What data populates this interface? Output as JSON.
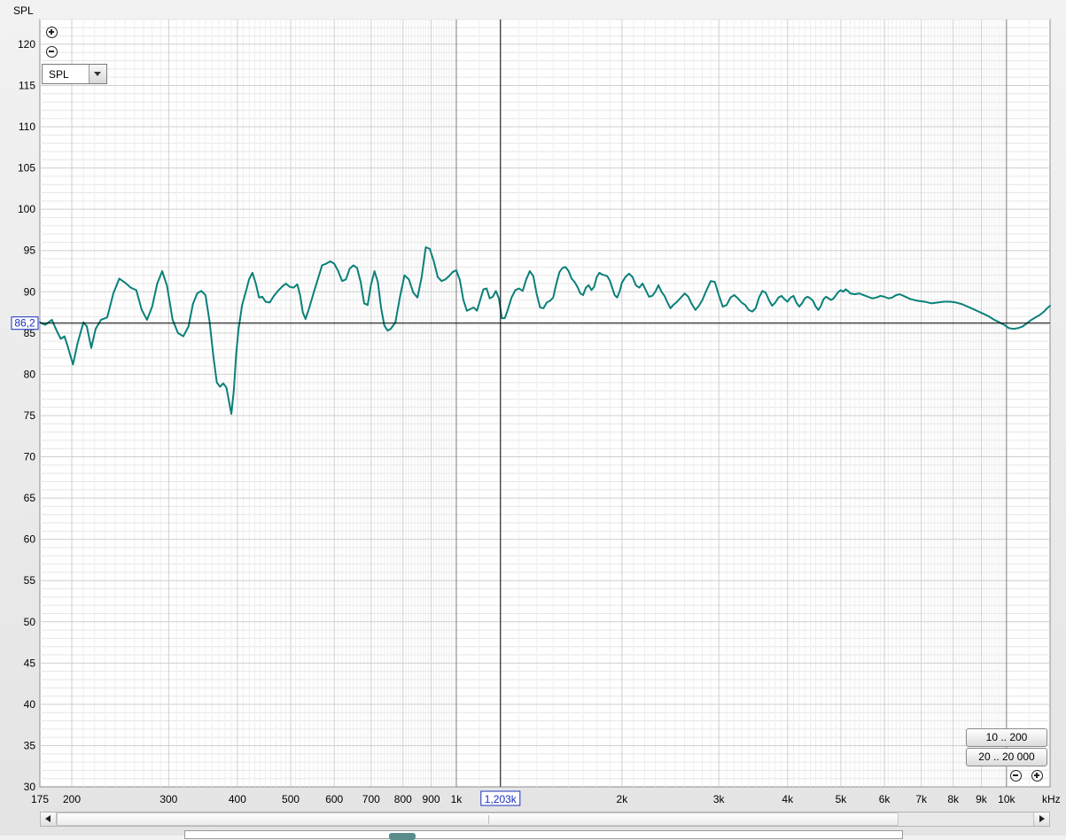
{
  "chart_data": {
    "type": "line",
    "ylabel": "SPL",
    "x_unit": "kHz",
    "x_scale": "log",
    "xlim": [
      175,
      12000
    ],
    "ylim": [
      30,
      123
    ],
    "y_ticks": [
      30,
      35,
      40,
      45,
      50,
      55,
      60,
      65,
      70,
      75,
      80,
      85,
      90,
      95,
      100,
      105,
      110,
      115,
      120
    ],
    "x_ticks": [
      {
        "value": 175,
        "label": "175"
      },
      {
        "value": 200,
        "label": "200"
      },
      {
        "value": 300,
        "label": "300"
      },
      {
        "value": 400,
        "label": "400"
      },
      {
        "value": 500,
        "label": "500"
      },
      {
        "value": 600,
        "label": "600"
      },
      {
        "value": 700,
        "label": "700"
      },
      {
        "value": 800,
        "label": "800"
      },
      {
        "value": 900,
        "label": "900"
      },
      {
        "value": 1000,
        "label": "1k"
      },
      {
        "value": 2000,
        "label": "2k"
      },
      {
        "value": 3000,
        "label": "3k"
      },
      {
        "value": 4000,
        "label": "4k"
      },
      {
        "value": 5000,
        "label": "5k"
      },
      {
        "value": 6000,
        "label": "6k"
      },
      {
        "value": 7000,
        "label": "7k"
      },
      {
        "value": 8000,
        "label": "8k"
      },
      {
        "value": 9000,
        "label": "9k"
      },
      {
        "value": 10000,
        "label": "10k"
      }
    ],
    "grid": true,
    "cursor": {
      "x": 1203,
      "y": 86.2,
      "x_label": "1,203k",
      "y_label": "86,2"
    },
    "series": [
      {
        "color": "#0a8079",
        "points": [
          [
            175,
            86.3
          ],
          [
            179,
            86.0
          ],
          [
            184,
            86.6
          ],
          [
            188,
            85.2
          ],
          [
            191,
            84.3
          ],
          [
            194,
            84.6
          ],
          [
            197,
            83.2
          ],
          [
            201,
            81.2
          ],
          [
            205,
            83.8
          ],
          [
            210,
            86.3
          ],
          [
            213,
            85.8
          ],
          [
            217,
            83.2
          ],
          [
            221,
            85.5
          ],
          [
            226,
            86.6
          ],
          [
            232,
            86.9
          ],
          [
            238,
            89.8
          ],
          [
            244,
            91.6
          ],
          [
            250,
            91.1
          ],
          [
            256,
            90.5
          ],
          [
            262,
            90.2
          ],
          [
            268,
            87.8
          ],
          [
            274,
            86.6
          ],
          [
            280,
            88.2
          ],
          [
            286,
            91.0
          ],
          [
            292,
            92.5
          ],
          [
            298,
            90.7
          ],
          [
            305,
            86.6
          ],
          [
            312,
            85.0
          ],
          [
            319,
            84.6
          ],
          [
            326,
            85.8
          ],
          [
            332,
            88.5
          ],
          [
            338,
            89.8
          ],
          [
            344,
            90.1
          ],
          [
            350,
            89.6
          ],
          [
            356,
            86.4
          ],
          [
            362,
            82.0
          ],
          [
            367,
            79.0
          ],
          [
            372,
            78.5
          ],
          [
            377,
            78.9
          ],
          [
            382,
            78.4
          ],
          [
            386,
            76.8
          ],
          [
            390,
            75.2
          ],
          [
            394,
            78.0
          ],
          [
            398,
            82.5
          ],
          [
            402,
            85.5
          ],
          [
            408,
            88.4
          ],
          [
            414,
            89.9
          ],
          [
            420,
            91.5
          ],
          [
            426,
            92.3
          ],
          [
            432,
            91.0
          ],
          [
            438,
            89.3
          ],
          [
            444,
            89.4
          ],
          [
            450,
            88.8
          ],
          [
            458,
            88.7
          ],
          [
            466,
            89.5
          ],
          [
            474,
            90.1
          ],
          [
            482,
            90.6
          ],
          [
            490,
            91.0
          ],
          [
            498,
            90.6
          ],
          [
            506,
            90.5
          ],
          [
            514,
            90.9
          ],
          [
            520,
            89.6
          ],
          [
            526,
            87.5
          ],
          [
            532,
            86.7
          ],
          [
            540,
            88.0
          ],
          [
            550,
            89.8
          ],
          [
            560,
            91.5
          ],
          [
            570,
            93.2
          ],
          [
            580,
            93.4
          ],
          [
            590,
            93.7
          ],
          [
            600,
            93.4
          ],
          [
            610,
            92.5
          ],
          [
            620,
            91.3
          ],
          [
            630,
            91.5
          ],
          [
            640,
            92.8
          ],
          [
            650,
            93.2
          ],
          [
            660,
            92.9
          ],
          [
            670,
            91.2
          ],
          [
            680,
            88.6
          ],
          [
            690,
            88.4
          ],
          [
            700,
            90.9
          ],
          [
            710,
            92.5
          ],
          [
            720,
            91.2
          ],
          [
            730,
            88.0
          ],
          [
            740,
            85.9
          ],
          [
            750,
            85.3
          ],
          [
            760,
            85.5
          ],
          [
            775,
            86.3
          ],
          [
            790,
            89.4
          ],
          [
            805,
            92.0
          ],
          [
            820,
            91.5
          ],
          [
            835,
            89.9
          ],
          [
            850,
            89.3
          ],
          [
            865,
            91.8
          ],
          [
            880,
            95.4
          ],
          [
            895,
            95.2
          ],
          [
            910,
            93.7
          ],
          [
            925,
            91.8
          ],
          [
            940,
            91.3
          ],
          [
            955,
            91.5
          ],
          [
            970,
            91.9
          ],
          [
            985,
            92.4
          ],
          [
            1000,
            92.6
          ],
          [
            1015,
            91.4
          ],
          [
            1030,
            89.0
          ],
          [
            1045,
            87.7
          ],
          [
            1060,
            87.9
          ],
          [
            1075,
            88.1
          ],
          [
            1090,
            87.7
          ],
          [
            1105,
            89.0
          ],
          [
            1120,
            90.3
          ],
          [
            1135,
            90.4
          ],
          [
            1150,
            89.2
          ],
          [
            1165,
            89.4
          ],
          [
            1180,
            90.1
          ],
          [
            1195,
            89.2
          ],
          [
            1210,
            86.8
          ],
          [
            1225,
            86.8
          ],
          [
            1240,
            87.8
          ],
          [
            1260,
            89.3
          ],
          [
            1280,
            90.2
          ],
          [
            1300,
            90.4
          ],
          [
            1320,
            90.1
          ],
          [
            1340,
            91.5
          ],
          [
            1360,
            92.5
          ],
          [
            1380,
            91.9
          ],
          [
            1400,
            89.7
          ],
          [
            1420,
            88.1
          ],
          [
            1440,
            88.0
          ],
          [
            1460,
            88.7
          ],
          [
            1480,
            88.9
          ],
          [
            1500,
            89.3
          ],
          [
            1520,
            91.0
          ],
          [
            1540,
            92.4
          ],
          [
            1560,
            92.9
          ],
          [
            1580,
            93.0
          ],
          [
            1600,
            92.5
          ],
          [
            1620,
            91.6
          ],
          [
            1640,
            91.2
          ],
          [
            1660,
            90.6
          ],
          [
            1680,
            89.8
          ],
          [
            1700,
            89.6
          ],
          [
            1720,
            90.5
          ],
          [
            1740,
            90.8
          ],
          [
            1760,
            90.2
          ],
          [
            1780,
            90.6
          ],
          [
            1800,
            91.8
          ],
          [
            1820,
            92.3
          ],
          [
            1840,
            92.1
          ],
          [
            1860,
            92.0
          ],
          [
            1880,
            91.9
          ],
          [
            1900,
            91.4
          ],
          [
            1920,
            90.5
          ],
          [
            1940,
            89.6
          ],
          [
            1960,
            89.3
          ],
          [
            1980,
            90.0
          ],
          [
            2000,
            91.1
          ],
          [
            2030,
            91.8
          ],
          [
            2060,
            92.2
          ],
          [
            2090,
            91.8
          ],
          [
            2120,
            90.8
          ],
          [
            2150,
            90.5
          ],
          [
            2180,
            91.0
          ],
          [
            2210,
            90.2
          ],
          [
            2240,
            89.4
          ],
          [
            2270,
            89.5
          ],
          [
            2300,
            90.0
          ],
          [
            2330,
            90.8
          ],
          [
            2360,
            90.0
          ],
          [
            2390,
            89.5
          ],
          [
            2420,
            88.7
          ],
          [
            2450,
            88.0
          ],
          [
            2480,
            88.4
          ],
          [
            2520,
            88.8
          ],
          [
            2560,
            89.3
          ],
          [
            2600,
            89.8
          ],
          [
            2640,
            89.4
          ],
          [
            2680,
            88.5
          ],
          [
            2720,
            87.8
          ],
          [
            2760,
            88.3
          ],
          [
            2800,
            89.0
          ],
          [
            2850,
            90.2
          ],
          [
            2900,
            91.3
          ],
          [
            2950,
            91.2
          ],
          [
            3000,
            89.6
          ],
          [
            3050,
            88.2
          ],
          [
            3100,
            88.4
          ],
          [
            3150,
            89.3
          ],
          [
            3200,
            89.6
          ],
          [
            3250,
            89.2
          ],
          [
            3300,
            88.7
          ],
          [
            3350,
            88.4
          ],
          [
            3400,
            87.8
          ],
          [
            3450,
            87.6
          ],
          [
            3500,
            88.0
          ],
          [
            3550,
            89.3
          ],
          [
            3600,
            90.1
          ],
          [
            3650,
            89.9
          ],
          [
            3700,
            89.0
          ],
          [
            3750,
            88.3
          ],
          [
            3800,
            88.7
          ],
          [
            3850,
            89.3
          ],
          [
            3900,
            89.5
          ],
          [
            3950,
            89.1
          ],
          [
            4000,
            88.8
          ],
          [
            4050,
            89.3
          ],
          [
            4100,
            89.5
          ],
          [
            4150,
            88.7
          ],
          [
            4200,
            88.2
          ],
          [
            4250,
            88.6
          ],
          [
            4300,
            89.2
          ],
          [
            4350,
            89.4
          ],
          [
            4400,
            89.2
          ],
          [
            4450,
            88.9
          ],
          [
            4500,
            88.2
          ],
          [
            4550,
            87.8
          ],
          [
            4600,
            88.3
          ],
          [
            4650,
            89.1
          ],
          [
            4700,
            89.4
          ],
          [
            4750,
            89.2
          ],
          [
            4800,
            89.0
          ],
          [
            4850,
            89.2
          ],
          [
            4900,
            89.6
          ],
          [
            4950,
            90.0
          ],
          [
            5000,
            90.2
          ],
          [
            5050,
            90.0
          ],
          [
            5100,
            90.3
          ],
          [
            5150,
            90.1
          ],
          [
            5200,
            89.8
          ],
          [
            5300,
            89.7
          ],
          [
            5400,
            89.8
          ],
          [
            5500,
            89.6
          ],
          [
            5600,
            89.4
          ],
          [
            5700,
            89.2
          ],
          [
            5800,
            89.3
          ],
          [
            5900,
            89.5
          ],
          [
            6000,
            89.4
          ],
          [
            6100,
            89.2
          ],
          [
            6200,
            89.3
          ],
          [
            6300,
            89.6
          ],
          [
            6400,
            89.7
          ],
          [
            6500,
            89.5
          ],
          [
            6700,
            89.1
          ],
          [
            6900,
            88.9
          ],
          [
            7100,
            88.8
          ],
          [
            7300,
            88.6
          ],
          [
            7500,
            88.7
          ],
          [
            7700,
            88.8
          ],
          [
            7900,
            88.8
          ],
          [
            8100,
            88.7
          ],
          [
            8300,
            88.5
          ],
          [
            8500,
            88.2
          ],
          [
            8700,
            87.9
          ],
          [
            8900,
            87.6
          ],
          [
            9100,
            87.3
          ],
          [
            9300,
            87.0
          ],
          [
            9500,
            86.6
          ],
          [
            9700,
            86.3
          ],
          [
            9900,
            86.0
          ],
          [
            10100,
            85.6
          ],
          [
            10300,
            85.5
          ],
          [
            10500,
            85.6
          ],
          [
            10700,
            85.8
          ],
          [
            10900,
            86.2
          ],
          [
            11100,
            86.6
          ],
          [
            11300,
            86.9
          ],
          [
            11500,
            87.2
          ],
          [
            11700,
            87.6
          ],
          [
            11850,
            88.0
          ],
          [
            12000,
            88.3
          ]
        ]
      }
    ]
  },
  "controls": {
    "zoom_in_icon": "zoom-in-icon",
    "zoom_out_icon": "zoom-out-icon",
    "measure_select": {
      "value": "SPL"
    },
    "range_buttons": [
      "10 .. 200",
      "20 .. 20 000"
    ]
  }
}
